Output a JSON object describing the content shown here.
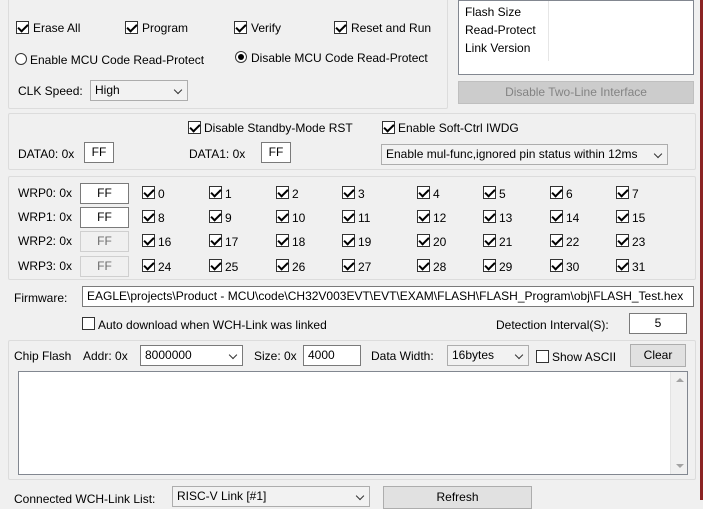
{
  "options": {
    "erase_all": "Erase All",
    "program": "Program",
    "verify": "Verify",
    "reset_and_run": "Reset and Run",
    "enable_read_protect": "Enable MCU Code Read-Protect",
    "disable_read_protect": "Disable MCU Code Read-Protect",
    "clk_speed_label": "CLK Speed:",
    "clk_speed_value": "High"
  },
  "info_table": {
    "rows": [
      "Flash Size",
      "Read-Protect",
      "Link Version"
    ]
  },
  "disable_two_line_button": "Disable Two-Line Interface",
  "user_bytes": {
    "disable_standby_rst": "Disable Standby-Mode RST",
    "enable_soft_iwdg": "Enable Soft-Ctrl IWDG",
    "data0_label": "DATA0: 0x",
    "data0_value": "FF",
    "data1_label": "DATA1: 0x",
    "data1_value": "FF",
    "pin_mode_value": "Enable mul-func,ignored pin status within 12ms"
  },
  "wrp": {
    "rows": [
      {
        "label": "WRP0: 0x",
        "value": "FF",
        "bits": [
          "0",
          "1",
          "2",
          "3",
          "4",
          "5",
          "6",
          "7"
        ]
      },
      {
        "label": "WRP1: 0x",
        "value": "FF",
        "bits": [
          "8",
          "9",
          "10",
          "11",
          "12",
          "13",
          "14",
          "15"
        ]
      },
      {
        "label": "WRP2: 0x",
        "value": "FF",
        "bits": [
          "16",
          "17",
          "18",
          "19",
          "20",
          "21",
          "22",
          "23"
        ]
      },
      {
        "label": "WRP3: 0x",
        "value": "FF",
        "bits": [
          "24",
          "25",
          "26",
          "27",
          "28",
          "29",
          "30",
          "31"
        ]
      }
    ]
  },
  "firmware": {
    "label": "Firmware:",
    "path": "EAGLE\\projects\\Product - MCU\\code\\CH32V003EVT\\EVT\\EXAM\\FLASH\\FLASH_Program\\obj\\FLASH_Test.hex",
    "auto_download": "Auto download when WCH-Link was linked",
    "detection_label": "Detection Interval(S):",
    "detection_value": "5"
  },
  "chip_flash": {
    "label": "Chip Flash",
    "addr_label": "Addr: 0x",
    "addr_value": "8000000",
    "size_label": "Size: 0x",
    "size_value": "4000",
    "width_label": "Data Width:",
    "width_value": "16bytes",
    "show_ascii": "Show ASCII",
    "clear_button": "Clear"
  },
  "link_list": {
    "label": "Connected WCH-Link List:",
    "value": "RISC-V Link [#1]",
    "refresh_button": "Refresh"
  }
}
